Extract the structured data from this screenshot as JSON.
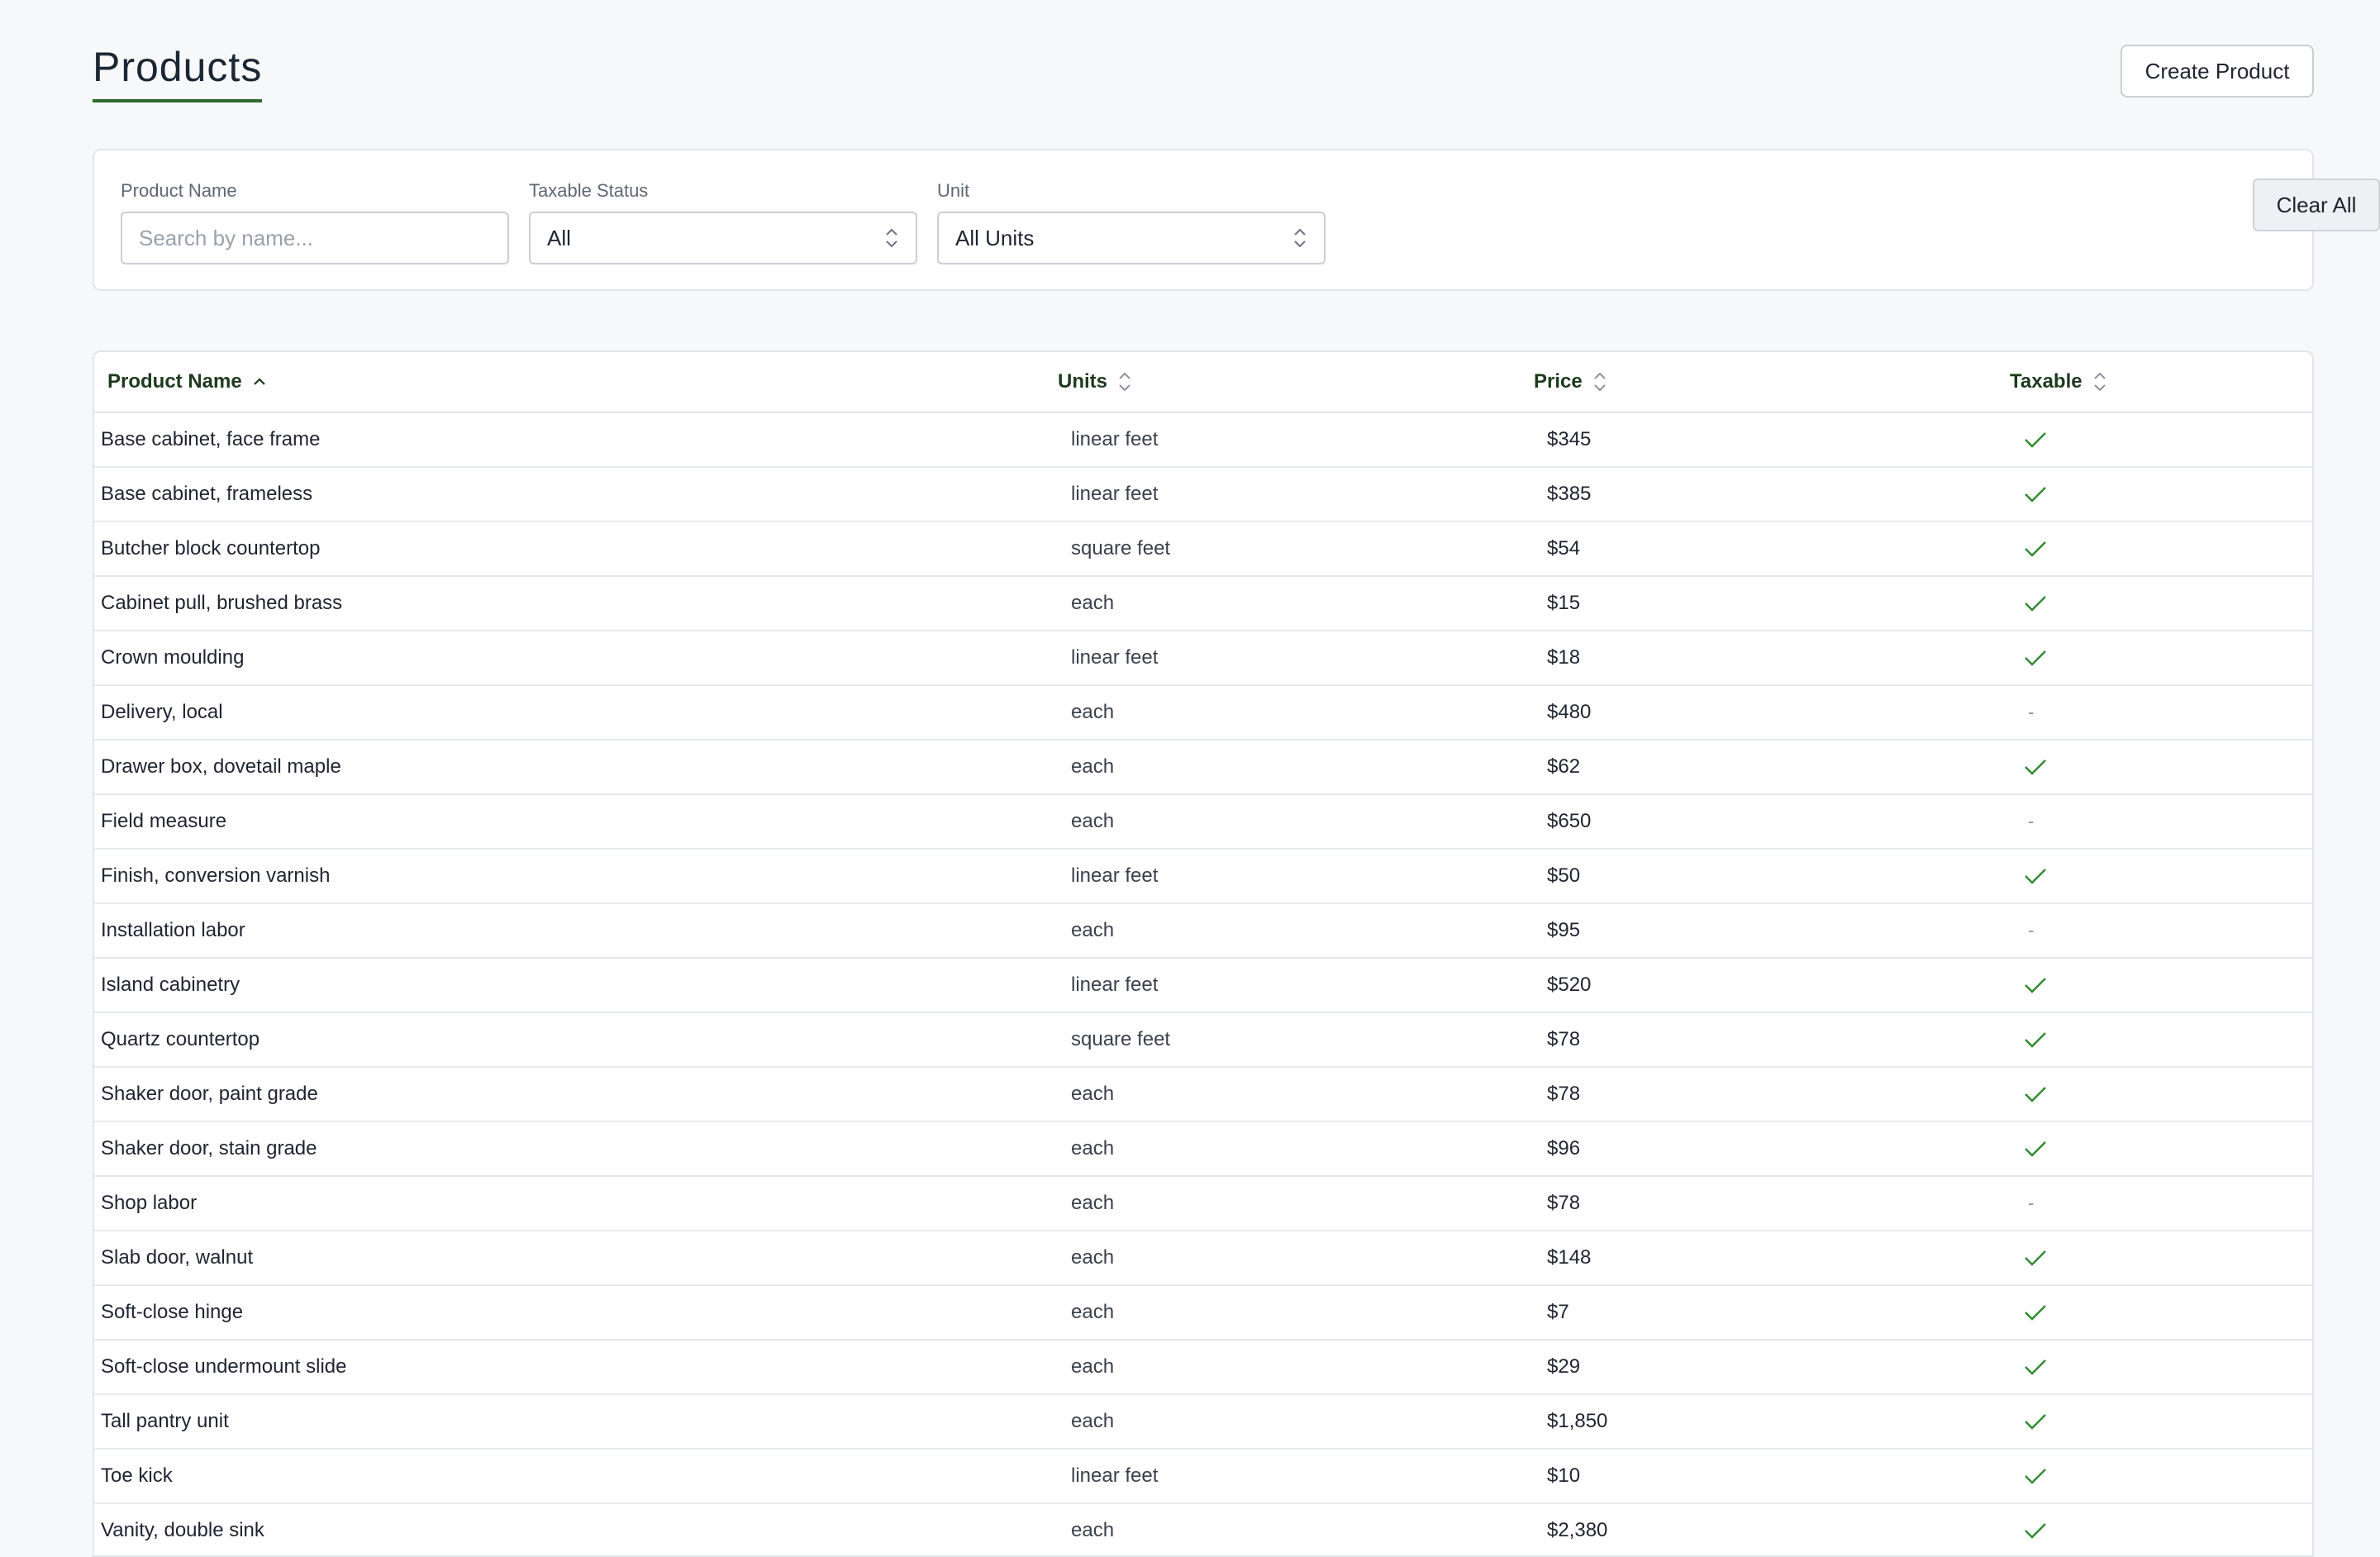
{
  "header": {
    "title": "Products",
    "create_button": "Create Product"
  },
  "filters": {
    "name": {
      "label": "Product Name",
      "placeholder": "Search by name...",
      "value": ""
    },
    "taxable": {
      "label": "Taxable Status",
      "value": "All"
    },
    "unit": {
      "label": "Unit",
      "value": "All Units"
    },
    "clear_button": "Clear All"
  },
  "table": {
    "columns": [
      {
        "label": "Product Name",
        "sort": "asc"
      },
      {
        "label": "Units",
        "sort": "none"
      },
      {
        "label": "Price",
        "sort": "none"
      },
      {
        "label": "Taxable",
        "sort": "none"
      }
    ],
    "rows": [
      {
        "name": "Base cabinet, face frame",
        "units": "linear feet",
        "price": "$345",
        "taxable": true
      },
      {
        "name": "Base cabinet, frameless",
        "units": "linear feet",
        "price": "$385",
        "taxable": true
      },
      {
        "name": "Butcher block countertop",
        "units": "square feet",
        "price": "$54",
        "taxable": true
      },
      {
        "name": "Cabinet pull, brushed brass",
        "units": "each",
        "price": "$15",
        "taxable": true
      },
      {
        "name": "Crown moulding",
        "units": "linear feet",
        "price": "$18",
        "taxable": true
      },
      {
        "name": "Delivery, local",
        "units": "each",
        "price": "$480",
        "taxable": false
      },
      {
        "name": "Drawer box, dovetail maple",
        "units": "each",
        "price": "$62",
        "taxable": true
      },
      {
        "name": "Field measure",
        "units": "each",
        "price": "$650",
        "taxable": false
      },
      {
        "name": "Finish, conversion varnish",
        "units": "linear feet",
        "price": "$50",
        "taxable": true
      },
      {
        "name": "Installation labor",
        "units": "each",
        "price": "$95",
        "taxable": false
      },
      {
        "name": "Island cabinetry",
        "units": "linear feet",
        "price": "$520",
        "taxable": true
      },
      {
        "name": "Quartz countertop",
        "units": "square feet",
        "price": "$78",
        "taxable": true
      },
      {
        "name": "Shaker door, paint grade",
        "units": "each",
        "price": "$78",
        "taxable": true
      },
      {
        "name": "Shaker door, stain grade",
        "units": "each",
        "price": "$96",
        "taxable": true
      },
      {
        "name": "Shop labor",
        "units": "each",
        "price": "$78",
        "taxable": false
      },
      {
        "name": "Slab door, walnut",
        "units": "each",
        "price": "$148",
        "taxable": true
      },
      {
        "name": "Soft-close hinge",
        "units": "each",
        "price": "$7",
        "taxable": true
      },
      {
        "name": "Soft-close undermount slide",
        "units": "each",
        "price": "$29",
        "taxable": true
      },
      {
        "name": "Tall pantry unit",
        "units": "each",
        "price": "$1,850",
        "taxable": true
      },
      {
        "name": "Toe kick",
        "units": "linear feet",
        "price": "$10",
        "taxable": true
      },
      {
        "name": "Vanity, double sink",
        "units": "each",
        "price": "$2,380",
        "taxable": true
      }
    ],
    "taxable_false_symbol": "-"
  },
  "colors": {
    "accent": "#2e6b2e",
    "check": "#2f8a2f",
    "header_text": "#1d3a1d"
  },
  "icons": {
    "sort_asc": "chevron-up-icon",
    "sort_none": "sort-updown-icon",
    "taxable_true": "check-icon",
    "select": "updown-icon"
  }
}
